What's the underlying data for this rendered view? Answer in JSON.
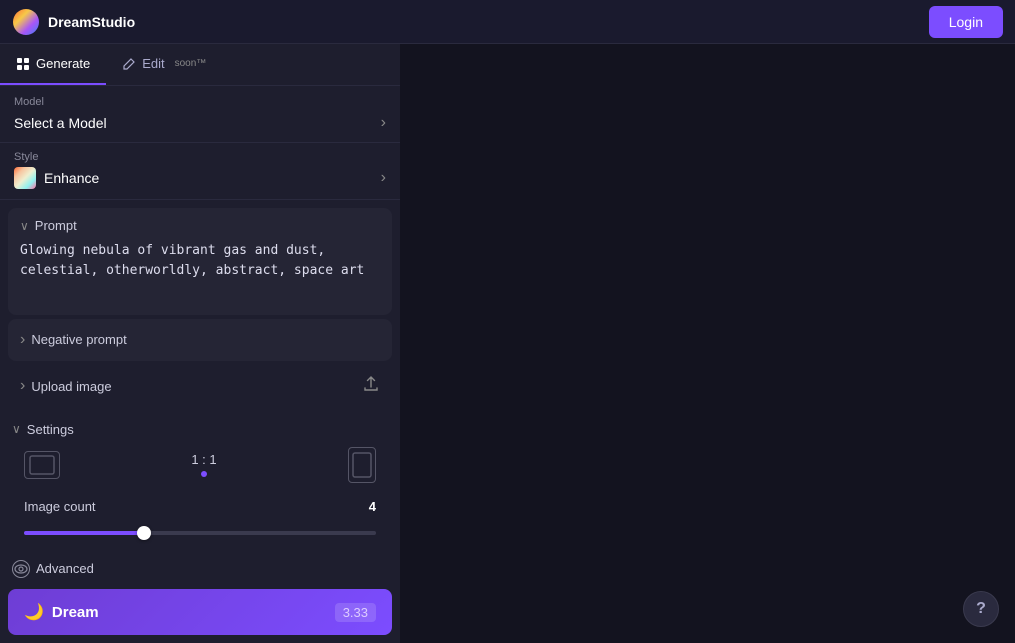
{
  "header": {
    "logo_text": "DreamStudio",
    "login_label": "Login"
  },
  "tabs": [
    {
      "id": "generate",
      "label": "Generate",
      "active": true,
      "soon": false
    },
    {
      "id": "edit",
      "label": "Edit",
      "active": false,
      "soon": true
    }
  ],
  "sidebar": {
    "model": {
      "label": "Model",
      "placeholder": "Select a Model"
    },
    "style": {
      "label": "Style",
      "value": "Enhance"
    },
    "prompt": {
      "section_label": "Prompt",
      "value": "Glowing nebula of vibrant gas and dust, celestial, otherworldly, abstract, space art"
    },
    "negative_prompt": {
      "label": "Negative prompt"
    },
    "upload_image": {
      "label": "Upload image"
    },
    "settings": {
      "label": "Settings",
      "aspect_ratio": {
        "value": "1 : 1"
      },
      "image_count": {
        "label": "Image count",
        "value": "4",
        "slider_percent": 35
      }
    },
    "advanced": {
      "label": "Advanced"
    },
    "dream_button": {
      "label": "Dream",
      "cost": "3.33"
    }
  },
  "help": {
    "label": "?"
  }
}
